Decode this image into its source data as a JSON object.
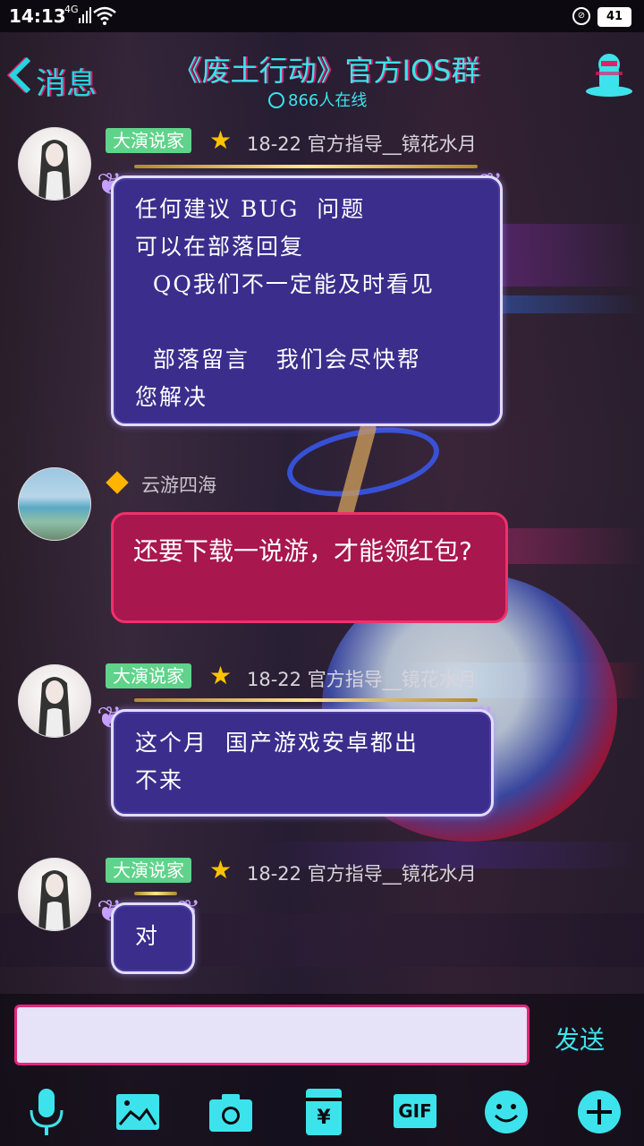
{
  "status": {
    "time": "14:13",
    "network": "4G",
    "battery": "41"
  },
  "header": {
    "back_label": "消息",
    "title": "《废土行动》官方IOS群",
    "online": "866人在线"
  },
  "messages": [
    {
      "badge": "大演说家",
      "meta": "18-22  官方指导__镜花水月",
      "text": "任何建议 BUG  问题\n可以在部落回复\n  QQ我们不一定能及时看见\n\n  部落留言   我们会尽快帮\n您解决"
    },
    {
      "sender": "云游四海",
      "text": "还要下载一说游，才能领红包?"
    },
    {
      "badge": "大演说家",
      "meta": "18-22  官方指导__镜花水月",
      "text": "这个月  国产游戏安卓都出\n不来"
    },
    {
      "badge": "大演说家",
      "meta": "18-22  官方指导__镜花水月",
      "text": "对"
    }
  ],
  "composer": {
    "input_value": "",
    "send_label": "发送",
    "toolbar": [
      "microphone-icon",
      "image-icon",
      "camera-icon",
      "red-packet-icon",
      "gif-icon",
      "emoji-icon",
      "plus-icon"
    ],
    "gif_label": "GIF",
    "yen_label": "¥"
  },
  "colors": {
    "accent_cyan": "#3de3ec",
    "accent_pink": "#e02878",
    "bubble_blue": "#3b2d8c",
    "bubble_red": "#a8174e",
    "badge_green": "#5fd38a"
  }
}
